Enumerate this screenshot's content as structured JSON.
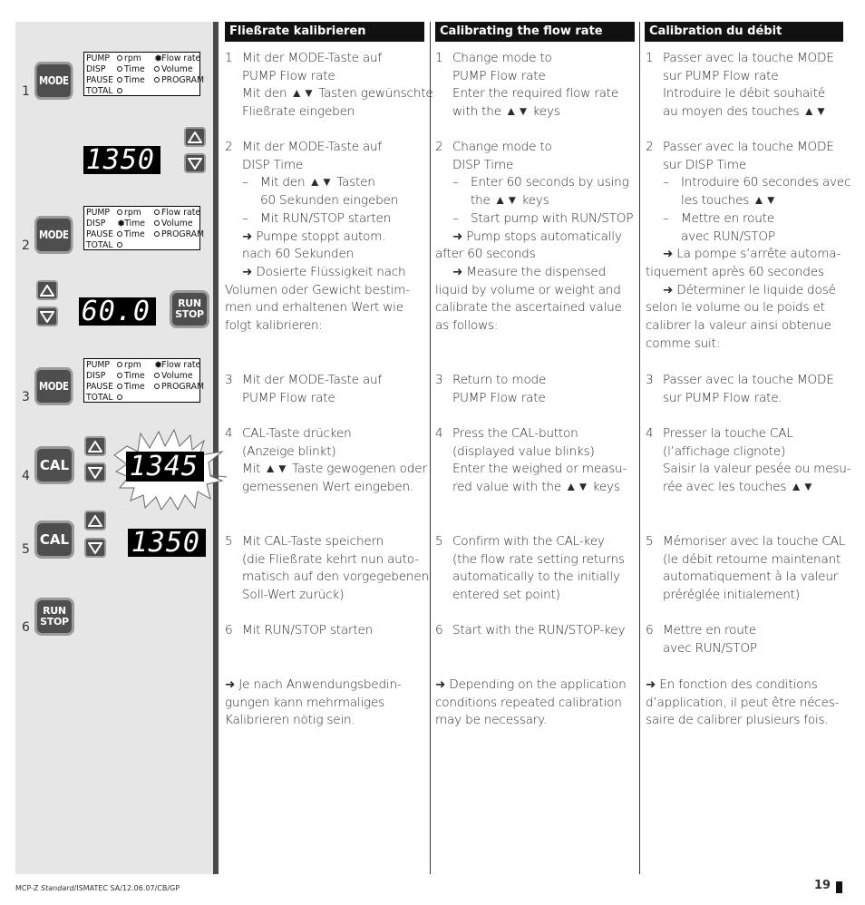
{
  "left_panel": {
    "step_numbers": [
      "1",
      "2",
      "3",
      "4",
      "5",
      "6"
    ],
    "keys": {
      "mode": "MODE",
      "cal": "CAL",
      "run_line1": "RUN",
      "run_line2": "STOP"
    },
    "displays": {
      "step1": "1350",
      "step2": "60.0",
      "step4": "1345",
      "step5": "1350"
    },
    "mode_indicator": {
      "rows": [
        {
          "label": "PUMP",
          "opt1": "rpm",
          "opt2": "Flow rate"
        },
        {
          "label": "DISP",
          "opt1": "Time",
          "opt2": "Volume"
        },
        {
          "label": "PAUSE",
          "opt1": "Time",
          "opt2": "PROGRAM"
        },
        {
          "label": "TOTAL",
          "opt1": "",
          "opt2": ""
        }
      ],
      "step1_active": "PUMP Flow rate",
      "step2_active": "DISP Time",
      "step3_active": "PUMP Flow rate"
    }
  },
  "columns": {
    "de": {
      "heading": "Fließrate kalibrieren",
      "steps": {
        "s1": [
          "Mit der MODE-Taste auf",
          "PUMP Flow rate",
          "Mit den ▲▼ Tasten gewünschte",
          "Fließrate eingeben"
        ],
        "s2": {
          "lines": [
            "Mit der MODE-Taste auf",
            "DISP Time"
          ],
          "sub1": [
            "Mit den ▲▼ Tasten",
            "60 Sekunden eingeben"
          ],
          "sub2": "Mit RUN/STOP starten",
          "note1": [
            "➜ Pumpe stoppt autom.",
            "nach 60 Sekunden"
          ],
          "note2": [
            "➜ Dosierte Flüssigkeit nach",
            "Volumen oder Gewicht bestim-",
            "men und erhaltenen Wert wie",
            "folgt kalibrieren:"
          ]
        },
        "s3": [
          "Mit der MODE-Taste auf",
          "PUMP Flow rate"
        ],
        "s4": [
          "CAL-Taste drücken",
          "(Anzeige blinkt)",
          "Mit ▲▼ Taste gewogenen oder",
          "gemessenen Wert eingeben."
        ],
        "s5": [
          "Mit CAL-Taste speichern",
          "(die Fließrate kehrt nun auto-",
          "matisch auf den vorgegebenen",
          "Soll-Wert zurück)"
        ],
        "s6": [
          "Mit RUN/STOP starten"
        ],
        "final": [
          "➜ Je nach Anwendungsbedin-",
          "gungen kann mehrmaliges",
          "Kalibrieren nötig sein."
        ]
      }
    },
    "en": {
      "heading": "Calibrating the flow rate",
      "steps": {
        "s1": [
          "Change mode to",
          "PUMP Flow rate",
          "Enter the required flow rate",
          "with the ▲▼ keys"
        ],
        "s2": {
          "lines": [
            "Change mode to",
            "DISP Time"
          ],
          "sub1": [
            "Enter 60 seconds by using",
            "the ▲▼ keys"
          ],
          "sub2": "Start pump with RUN/STOP",
          "note1": [
            "➜ Pump stops automatically",
            "after 60 seconds"
          ],
          "note2": [
            "➜ Measure the dispensed",
            "liquid by volume or weight and",
            "calibrate the ascertained value",
            "as follows:"
          ]
        },
        "s3": [
          "Return to mode",
          "PUMP Flow rate"
        ],
        "s4": [
          "Press the CAL-button",
          "(displayed value blinks)",
          "Enter the weighed or measu-",
          "red value with the ▲▼ keys"
        ],
        "s5": [
          "Confirm with the CAL-key",
          "(the flow rate setting returns",
          "automatically to the initially",
          "entered set point)"
        ],
        "s6": [
          "Start with the RUN/STOP-key"
        ],
        "final": [
          "➜ Depending on the application",
          "conditions repeated calibration",
          "may be necessary."
        ]
      }
    },
    "fr": {
      "heading": "Calibration du débit",
      "steps": {
        "s1": [
          "Passer avec la touche MODE",
          "sur PUMP Flow rate",
          "Introduire le débit souhaité",
          "au moyen des touches ▲▼"
        ],
        "s2": {
          "lines": [
            "Passer avec la touche MODE",
            "sur DISP Time"
          ],
          "sub1": [
            "Introduire 60 secondes avec",
            "les touches ▲▼"
          ],
          "sub2_lines": [
            "Mettre en route",
            "avec RUN/STOP"
          ],
          "note1": [
            "➜ La pompe s’arrête automa-",
            "tiquement après 60 secondes"
          ],
          "note2": [
            "➜ Déterminer le liquide dosé",
            "selon le volume ou le poids et",
            "calibrer la valeur ainsi obtenue",
            "comme suit:"
          ]
        },
        "s3": [
          "Passer avec la touche MODE",
          "sur PUMP Flow rate."
        ],
        "s4": [
          "Presser la touche CAL",
          "(l’affichage clignote)",
          "Saisir la valeur pesée ou mesu-",
          "rée avec les touches ▲▼"
        ],
        "s5": [
          "Mémoriser avec la touche CAL",
          "(le débit retourne maintenant",
          "automatiquement à la valeur",
          "préréglée initialement)"
        ],
        "s6": [
          "Mettre en route",
          "avec RUN/STOP"
        ],
        "final": [
          "➜  En fonction des conditions",
          "d’application, il peut être néces-",
          "saire de calibrer plusieurs fois."
        ]
      }
    }
  },
  "footer": {
    "doc_prefix": "MCP-Z ",
    "doc_italic": "Standard",
    "doc_suffix": "/ISMATEC SA/12.06.07/CB/GP",
    "page_number": "19"
  }
}
